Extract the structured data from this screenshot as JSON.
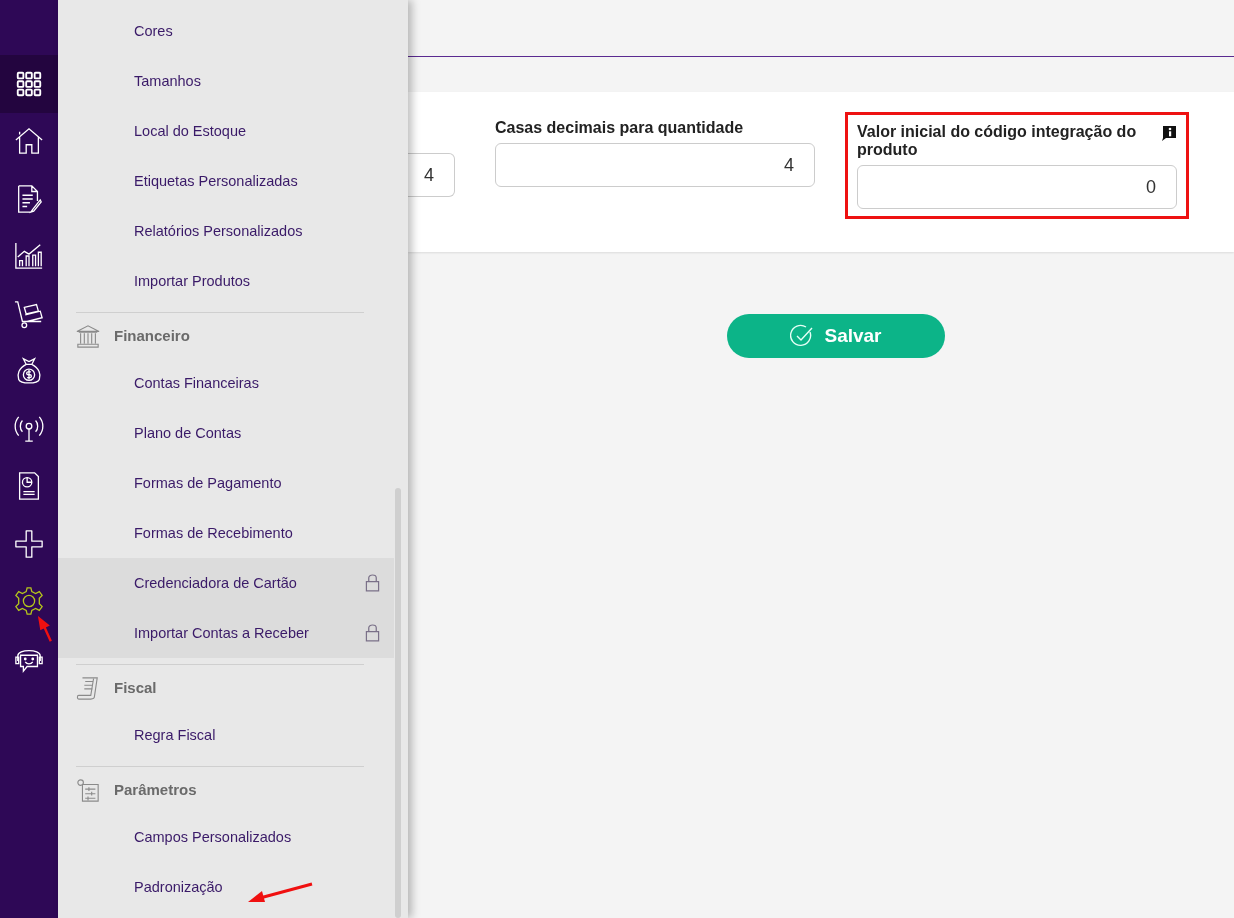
{
  "rail": [
    {
      "kind": "grid",
      "selected": true,
      "active": false,
      "annotated": false
    },
    {
      "kind": "home",
      "selected": false,
      "active": false,
      "annotated": false
    },
    {
      "kind": "document",
      "selected": false,
      "active": false,
      "annotated": false
    },
    {
      "kind": "chart",
      "selected": false,
      "active": false,
      "annotated": false
    },
    {
      "kind": "cart",
      "selected": false,
      "active": false,
      "annotated": false
    },
    {
      "kind": "money",
      "selected": false,
      "active": false,
      "annotated": false
    },
    {
      "kind": "antenna",
      "selected": false,
      "active": false,
      "annotated": false
    },
    {
      "kind": "report",
      "selected": false,
      "active": false,
      "annotated": false
    },
    {
      "kind": "plus",
      "selected": false,
      "active": false,
      "annotated": false
    },
    {
      "kind": "gear",
      "selected": false,
      "active": true,
      "annotated": true
    },
    {
      "kind": "support",
      "selected": false,
      "active": false,
      "annotated": false
    }
  ],
  "menu": [
    {
      "kind": "item",
      "label": "Cores",
      "locked": false,
      "annotated": false
    },
    {
      "kind": "item",
      "label": "Tamanhos",
      "locked": false,
      "annotated": false
    },
    {
      "kind": "item",
      "label": "Local do Estoque",
      "locked": false,
      "annotated": false
    },
    {
      "kind": "item",
      "label": "Etiquetas Personalizadas",
      "locked": false,
      "annotated": false
    },
    {
      "kind": "item",
      "label": "Relatórios Personalizados",
      "locked": false,
      "annotated": false
    },
    {
      "kind": "item",
      "label": "Importar Produtos",
      "locked": false,
      "annotated": false
    },
    {
      "kind": "heading",
      "label": "Financeiro"
    },
    {
      "kind": "item",
      "label": "Contas Financeiras",
      "locked": false,
      "annotated": false
    },
    {
      "kind": "item",
      "label": "Plano de Contas",
      "locked": false,
      "annotated": false
    },
    {
      "kind": "item",
      "label": "Formas de Pagamento",
      "locked": false,
      "annotated": false
    },
    {
      "kind": "item",
      "label": "Formas de Recebimento",
      "locked": false,
      "annotated": false
    },
    {
      "kind": "item",
      "label": "Credenciadora de Cartão",
      "locked": true,
      "annotated": false
    },
    {
      "kind": "item",
      "label": "Importar Contas a Receber",
      "locked": true,
      "annotated": false
    },
    {
      "kind": "heading",
      "label": "Fiscal"
    },
    {
      "kind": "item",
      "label": "Regra Fiscal",
      "locked": false,
      "annotated": false
    },
    {
      "kind": "heading",
      "label": "Parâmetros"
    },
    {
      "kind": "item",
      "label": "Campos Personalizados",
      "locked": false,
      "annotated": false
    },
    {
      "kind": "item",
      "label": "Padronização",
      "locked": false,
      "annotated": true
    }
  ],
  "fields": [
    {
      "kind": "partial",
      "value": "4"
    },
    {
      "kind": "full",
      "label": "Casas decimais para quantidade",
      "value": "4",
      "info": false,
      "highlighted": false
    },
    {
      "kind": "full",
      "label": "Valor inicial do código integração do produto",
      "value": "0",
      "info": true,
      "highlighted": true
    }
  ],
  "save_button": {
    "label": "Salvar"
  }
}
